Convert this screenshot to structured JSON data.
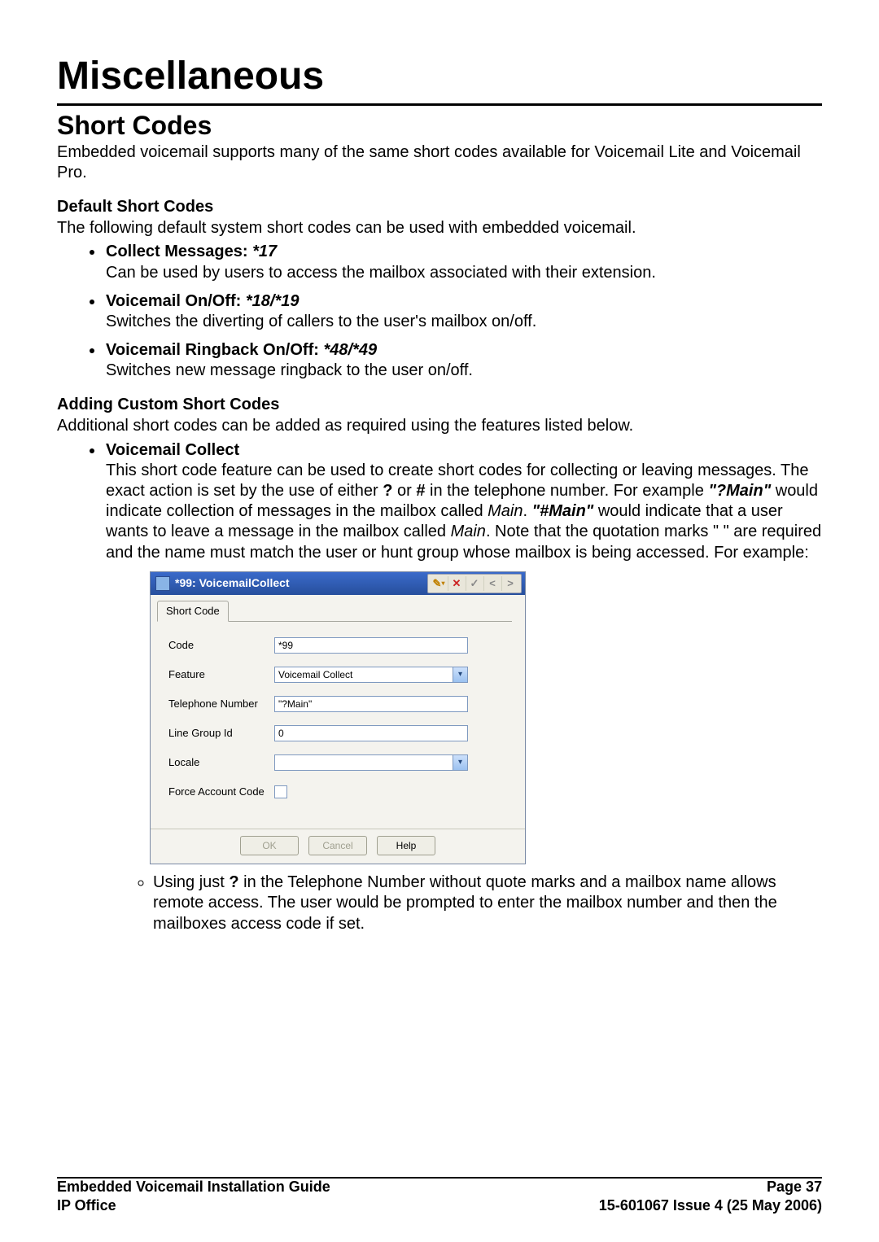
{
  "headings": {
    "h1": "Miscellaneous",
    "h2": "Short Codes",
    "h3a": "Default Short Codes",
    "h3b": "Adding Custom Short Codes"
  },
  "intro": "Embedded voicemail supports many of the same short codes available for Voicemail Lite and Voicemail Pro.",
  "default_intro": "The following default system short codes can be used with embedded voicemail.",
  "defaults": [
    {
      "label": "Collect Messages:",
      "code": "*17",
      "desc": "Can be used by users to access the mailbox associated with their extension."
    },
    {
      "label": "Voicemail On/Off:",
      "code": "*18/*19",
      "desc": "Switches the diverting of callers to the user's mailbox on/off."
    },
    {
      "label": "Voicemail Ringback On/Off:",
      "code": "*48/*49",
      "desc": "Switches new message ringback to the user on/off."
    }
  ],
  "custom_intro": "Additional short codes can be added as required using the features listed below.",
  "vm_collect": {
    "label": "Voicemail Collect",
    "p1a": "This short code feature can be used to create short codes for collecting or leaving messages. The exact action is set by the use of either ",
    "q": "?",
    "p1b": " or ",
    "hash": "#",
    "p1c": " in the telephone number. For example ",
    "ex1": "\"?Main\"",
    "p1d": " would indicate collection of messages in the mailbox called ",
    "main1": "Main",
    "p1e": ". ",
    "ex2": "\"#Main\"",
    "p1f": " would indicate that a user wants to leave a message in the mailbox called ",
    "main2": "Main",
    "p1g": ". Note that the quotation marks \" \" are required and the name must match the user or hunt group whose mailbox is being accessed. For example:",
    "sub_a": "Using just ",
    "sub_q": "?",
    "sub_b": " in the Telephone Number without quote marks and a mailbox name allows remote access. The user would be prompted to enter the mailbox number and then the mailboxes access code if set."
  },
  "dialog": {
    "title": "*99: VoicemailCollect",
    "tab": "Short Code",
    "labels": {
      "code": "Code",
      "feature": "Feature",
      "tel": "Telephone Number",
      "lgid": "Line Group Id",
      "locale": "Locale",
      "force": "Force Account Code"
    },
    "values": {
      "code": "*99",
      "feature": "Voicemail Collect",
      "tel": "\"?Main\"",
      "lgid": "0",
      "locale": ""
    },
    "buttons": {
      "ok": "OK",
      "cancel": "Cancel",
      "help": "Help"
    }
  },
  "footer": {
    "left1": "Embedded Voicemail Installation Guide",
    "left2": "IP Office",
    "right1": "Page 37",
    "right2": "15-601067 Issue 4 (25 May 2006)"
  }
}
